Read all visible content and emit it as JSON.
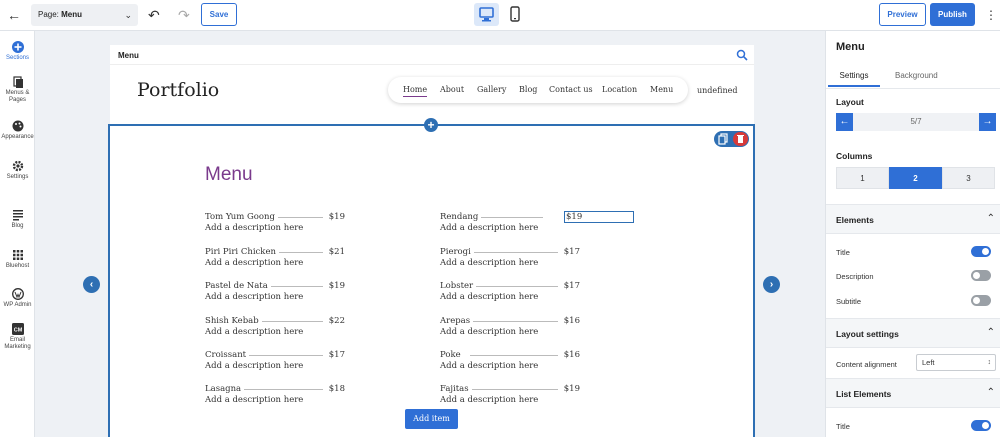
{
  "topbar": {
    "page_prefix": "Page:",
    "page_name": "Menu",
    "save_label": "Save",
    "preview_label": "Preview",
    "publish_label": "Publish"
  },
  "leftbar": {
    "items": [
      {
        "label": "Sections",
        "icon": "plus-circle-icon",
        "active": true
      },
      {
        "label": "Menus & Pages",
        "icon": "pages-icon"
      },
      {
        "label": "Appearance",
        "icon": "palette-icon"
      },
      {
        "label": "Settings",
        "icon": "gear-icon"
      },
      {
        "label": "Blog",
        "icon": "blog-icon"
      },
      {
        "label": "Bluehost",
        "icon": "grid-icon"
      },
      {
        "label": "WP Admin",
        "icon": "wordpress-icon"
      },
      {
        "label": "Email Marketing",
        "icon": "email-marketing-icon"
      }
    ]
  },
  "canvas": {
    "frame_title": "Menu",
    "site": {
      "logo": "Portfolio",
      "nav": [
        "Home",
        "About",
        "Gallery",
        "Blog",
        "Contact us",
        "Location",
        "Menu"
      ],
      "nav_extra": "undefined"
    },
    "section": {
      "title": "Menu",
      "items": [
        {
          "name": "Tom Yum Goong",
          "price": "$19",
          "desc": "Add a description here"
        },
        {
          "name": "Rendang",
          "price": "$19",
          "desc": "Add a description here",
          "selected": true
        },
        {
          "name": "Piri Piri Chicken",
          "price": "$21",
          "desc": "Add a description here"
        },
        {
          "name": "Pierogi",
          "price": "$17",
          "desc": "Add a description here"
        },
        {
          "name": "Pastel de Nata",
          "price": "$19",
          "desc": "Add a description here"
        },
        {
          "name": "Lobster",
          "price": "$17",
          "desc": "Add a description here"
        },
        {
          "name": "Shish Kebab",
          "price": "$22",
          "desc": "Add a description here"
        },
        {
          "name": "Arepas",
          "price": "$16",
          "desc": "Add a description here"
        },
        {
          "name": "Croissant",
          "price": "$17",
          "desc": "Add a description here"
        },
        {
          "name": "Poke",
          "price": "$16",
          "desc": "Add a description here"
        },
        {
          "name": "Lasagna",
          "price": "$18",
          "desc": "Add a description here"
        },
        {
          "name": "Fajitas",
          "price": "$19",
          "desc": "Add a description here"
        }
      ],
      "add_item_label": "Add item"
    }
  },
  "panel": {
    "title": "Menu",
    "tabs": [
      "Settings",
      "Background"
    ],
    "layout_label": "Layout",
    "layout_value": "5/7",
    "columns_label": "Columns",
    "columns": [
      "1",
      "2",
      "3"
    ],
    "columns_selected": "2",
    "elements_label": "Elements",
    "elements": [
      {
        "label": "Title",
        "on": true
      },
      {
        "label": "Description",
        "on": false
      },
      {
        "label": "Subtitle",
        "on": false
      }
    ],
    "layout_settings_label": "Layout settings",
    "content_alignment_label": "Content alignment",
    "content_alignment_value": "Left",
    "list_elements_label": "List Elements",
    "list_elements": [
      {
        "label": "Title",
        "on": true
      }
    ]
  },
  "colors": {
    "accent": "#2f6fd6",
    "section_border": "#2e6fb3",
    "menu_title": "#7a3a8c",
    "delete": "#d73a3a"
  }
}
